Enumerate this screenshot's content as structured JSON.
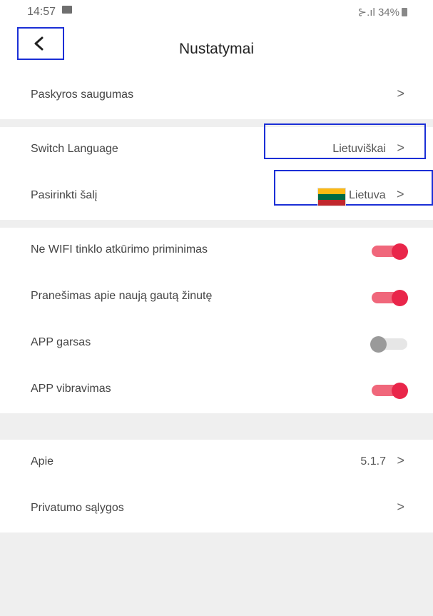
{
  "status_bar": {
    "time": "14:57",
    "signal_text": "⊱.ıl",
    "battery": "34%"
  },
  "header": {
    "title": "Nustatymai"
  },
  "security": {
    "label": "Paskyros saugumas"
  },
  "language": {
    "label": "Switch Language",
    "value": "Lietuviškai"
  },
  "country": {
    "label": "Pasirinkti šalį",
    "value": "Lietuva",
    "flag_colors": [
      "#fdb913",
      "#006a44",
      "#c1272d"
    ]
  },
  "toggles": [
    {
      "label": "Ne WIFI tinklo atkūrimo priminimas",
      "on": true
    },
    {
      "label": "Pranešimas apie naują gautą žinutę",
      "on": true
    },
    {
      "label": "APP garsas",
      "on": false
    },
    {
      "label": "APP vibravimas",
      "on": true
    }
  ],
  "about": {
    "label": "Apie",
    "value": "5.1.7"
  },
  "privacy": {
    "label": "Privatumo sąlygos"
  },
  "chevron": ">",
  "colors": {
    "accent": "#e9264a",
    "highlight_box": "#1b2fd6"
  }
}
